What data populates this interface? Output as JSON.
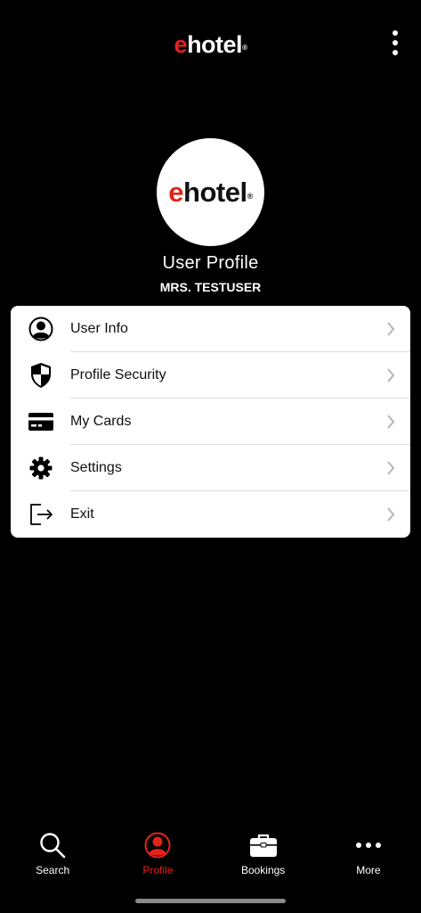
{
  "header": {
    "logo_e": "e",
    "logo_rest": "hotel",
    "logo_reg": "®"
  },
  "avatar": {
    "logo_e": "e",
    "logo_rest": "hotel",
    "logo_reg": "®"
  },
  "profile": {
    "title": "User Profile",
    "name": "MRS. TESTUSER"
  },
  "menu": {
    "items": [
      {
        "label": "User Info",
        "icon": "user-circle-icon"
      },
      {
        "label": "Profile Security",
        "icon": "shield-icon"
      },
      {
        "label": "My Cards",
        "icon": "credit-card-icon"
      },
      {
        "label": "Settings",
        "icon": "gear-icon"
      },
      {
        "label": "Exit",
        "icon": "logout-icon"
      }
    ]
  },
  "tabbar": {
    "tabs": [
      {
        "label": "Search",
        "icon": "search-icon",
        "active": false
      },
      {
        "label": "Profile",
        "icon": "profile-icon",
        "active": true
      },
      {
        "label": "Bookings",
        "icon": "briefcase-icon",
        "active": false
      },
      {
        "label": "More",
        "icon": "more-dots-icon",
        "active": false
      }
    ]
  },
  "colors": {
    "brand_red": "#e2231a",
    "background": "#000000",
    "card": "#ffffff",
    "chevron": "#b5b5b5"
  }
}
